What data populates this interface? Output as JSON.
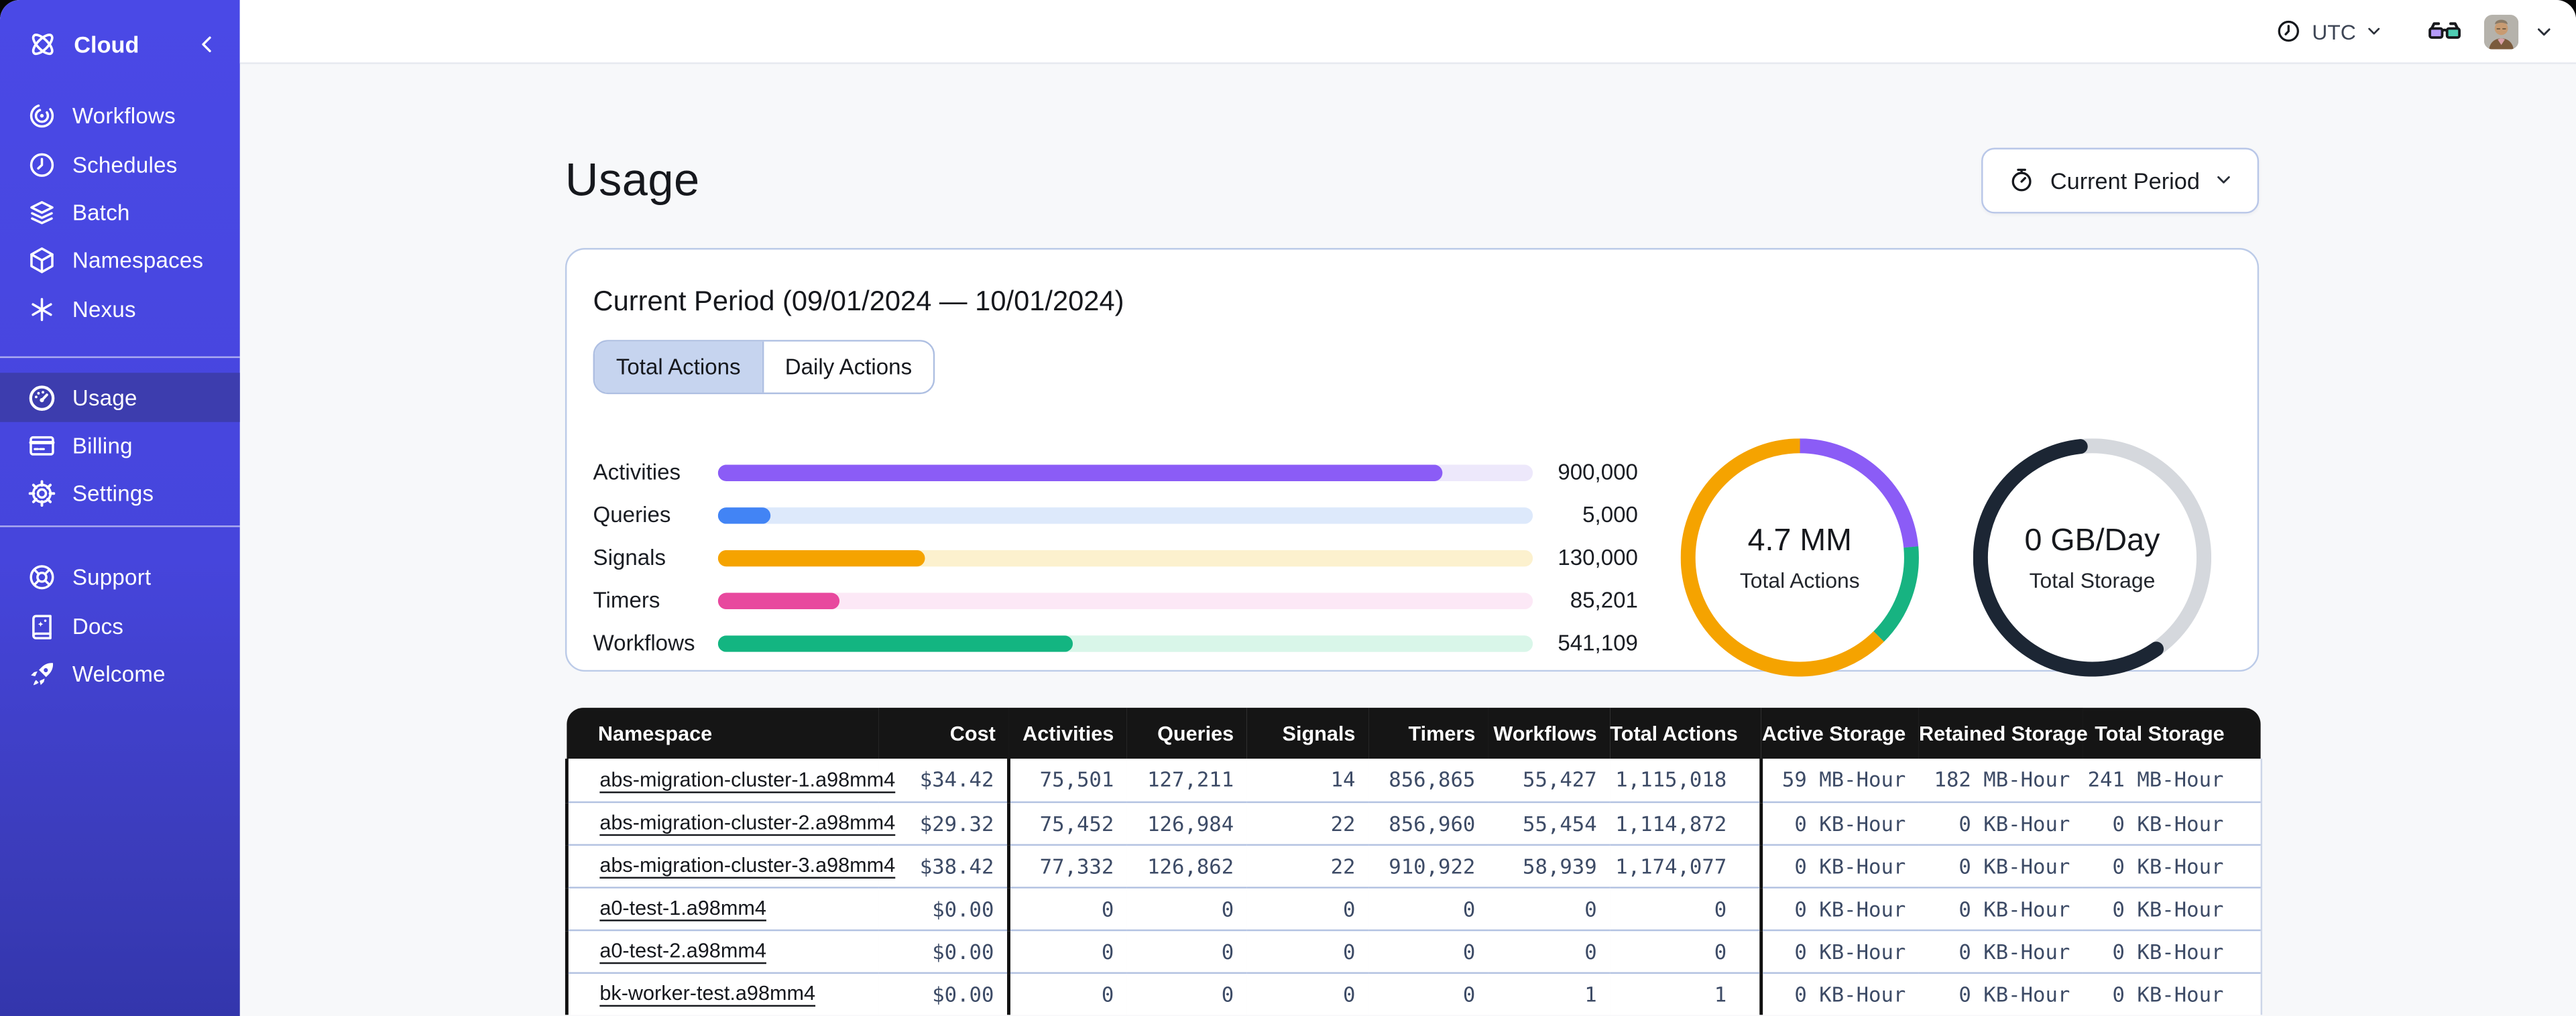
{
  "sidebar": {
    "brand": {
      "label": "Cloud",
      "icon": "temporal-logo-icon"
    },
    "nav_main": [
      {
        "icon": "workflows-icon",
        "label": "Workflows",
        "active": false
      },
      {
        "icon": "schedules-icon",
        "label": "Schedules",
        "active": false
      },
      {
        "icon": "batch-icon",
        "label": "Batch",
        "active": false
      },
      {
        "icon": "namespaces-icon",
        "label": "Namespaces",
        "active": false
      },
      {
        "icon": "nexus-icon",
        "label": "Nexus",
        "active": false
      }
    ],
    "nav_account": [
      {
        "icon": "usage-icon",
        "label": "Usage",
        "active": true
      },
      {
        "icon": "billing-icon",
        "label": "Billing",
        "active": false
      },
      {
        "icon": "settings-icon",
        "label": "Settings",
        "active": false
      }
    ],
    "nav_footer": [
      {
        "icon": "support-icon",
        "label": "Support",
        "active": false
      },
      {
        "icon": "docs-icon",
        "label": "Docs",
        "active": false
      },
      {
        "icon": "welcome-icon",
        "label": "Welcome",
        "active": false
      }
    ]
  },
  "topbar": {
    "timezone_label": "UTC"
  },
  "page": {
    "title": "Usage",
    "period_button_label": "Current Period"
  },
  "usage_card": {
    "title": "Current Period (09/01/2024 — 10/01/2024)",
    "tabs": [
      {
        "label": "Total Actions",
        "active": true
      },
      {
        "label": "Daily Actions",
        "active": false
      }
    ]
  },
  "chart_data": [
    {
      "type": "bar",
      "title": "Usage by action type",
      "categories": [
        "Activities",
        "Queries",
        "Signals",
        "Timers",
        "Workflows"
      ],
      "values": [
        900000,
        5000,
        130000,
        85201,
        541109
      ],
      "value_labels": [
        "900,000",
        "5,000",
        "130,000",
        "85,201",
        "541,109"
      ],
      "fill_percent": [
        88.9,
        6.4,
        25.5,
        14.9,
        43.6
      ],
      "colors": [
        "#8B5CF6",
        "#4284F5",
        "#F5A300",
        "#E8489E",
        "#13B581"
      ],
      "track_colors": [
        "#EDE8FB",
        "#DDE9FB",
        "#FCF1CE",
        "#FCE8F6",
        "#D9F6E9"
      ]
    },
    {
      "type": "pie",
      "title": "4.7 MM",
      "subtitle": "Total Actions",
      "segments": [
        {
          "name": "activities",
          "color": "#8B5CF6",
          "percent": 23.5
        },
        {
          "name": "workflows",
          "color": "#17B381",
          "percent": 14.0
        },
        {
          "name": "signals",
          "color": "#F5A300",
          "percent": 62.5
        }
      ]
    },
    {
      "type": "pie",
      "title": "0 GB/Day",
      "subtitle": "Total Storage",
      "segments": [
        {
          "name": "used",
          "color": "#1C2634",
          "percent": 58.0
        },
        {
          "name": "free",
          "color": "#D5D8DD",
          "percent": 42.0
        }
      ]
    }
  ],
  "table": {
    "headers": [
      "Namespace",
      "Cost",
      "Activities",
      "Queries",
      "Signals",
      "Timers",
      "Workflows",
      "Total Actions",
      "Active Storage",
      "Retained Storage",
      "Total Storage"
    ],
    "rows": [
      [
        "abs-migration-cluster-1.a98mm4",
        "$34.42",
        "75,501",
        "127,211",
        "14",
        "856,865",
        "55,427",
        "1,115,018",
        "59 MB-Hour",
        "182 MB-Hour",
        "241 MB-Hour"
      ],
      [
        "abs-migration-cluster-2.a98mm4",
        "$29.32",
        "75,452",
        "126,984",
        "22",
        "856,960",
        "55,454",
        "1,114,872",
        "0 KB-Hour",
        "0 KB-Hour",
        "0 KB-Hour"
      ],
      [
        "abs-migration-cluster-3.a98mm4",
        "$38.42",
        "77,332",
        "126,862",
        "22",
        "910,922",
        "58,939",
        "1,174,077",
        "0 KB-Hour",
        "0 KB-Hour",
        "0 KB-Hour"
      ],
      [
        "a0-test-1.a98mm4",
        "$0.00",
        "0",
        "0",
        "0",
        "0",
        "0",
        "0",
        "0 KB-Hour",
        "0 KB-Hour",
        "0 KB-Hour"
      ],
      [
        "a0-test-2.a98mm4",
        "$0.00",
        "0",
        "0",
        "0",
        "0",
        "0",
        "0",
        "0 KB-Hour",
        "0 KB-Hour",
        "0 KB-Hour"
      ],
      [
        "bk-worker-test.a98mm4",
        "$0.00",
        "0",
        "0",
        "0",
        "0",
        "1",
        "1",
        "0 KB-Hour",
        "0 KB-Hour",
        "0 KB-Hour"
      ]
    ]
  }
}
